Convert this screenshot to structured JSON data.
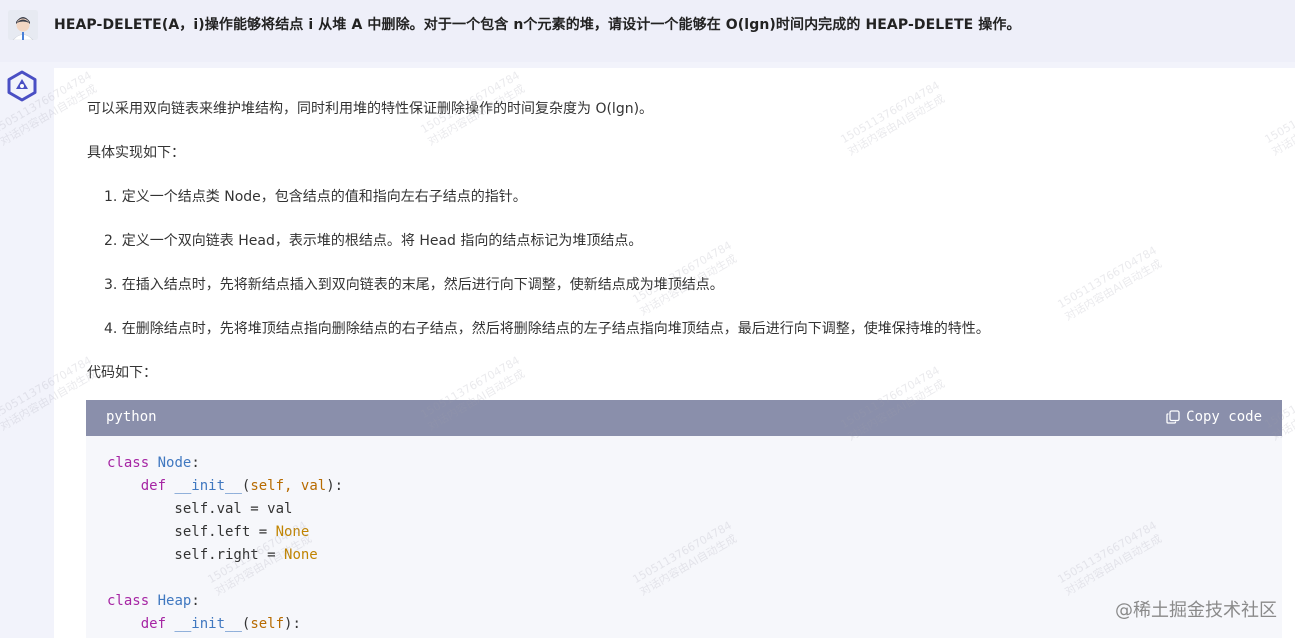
{
  "question": {
    "text": "HEAP-DELETE(A，i)操作能够将结点 i 从堆 A 中删除。对于一个包含 n个元素的堆，请设计一个能够在 O(lgn)时间内完成的 HEAP-DELETE 操作。"
  },
  "answer": {
    "intro": "可以采用双向链表来维护堆结构，同时利用堆的特性保证删除操作的时间复杂度为 O(lgn)。",
    "steps_heading": "具体实现如下：",
    "steps": [
      "1. 定义一个结点类 Node，包含结点的值和指向左右子结点的指针。",
      "2. 定义一个双向链表 Head，表示堆的根结点。将 Head 指向的结点标记为堆顶结点。",
      "3. 在插入结点时，先将新结点插入到双向链表的末尾，然后进行向下调整，使新结点成为堆顶结点。",
      "4. 在删除结点时，先将堆顶结点指向删除结点的右子结点，然后将删除结点的左子结点指向堆顶结点，最后进行向下调整，使堆保持堆的特性。"
    ],
    "code_heading": "代码如下："
  },
  "code_block": {
    "language": "python",
    "copy_label": "Copy code",
    "lines": [
      [
        {
          "t": "class",
          "c": "kw"
        },
        {
          "t": " "
        },
        {
          "t": "Node",
          "c": "cls"
        },
        {
          "t": ":"
        }
      ],
      [
        {
          "t": "    "
        },
        {
          "t": "def",
          "c": "kw"
        },
        {
          "t": " "
        },
        {
          "t": "__init__",
          "c": "fn"
        },
        {
          "t": "("
        },
        {
          "t": "self, val",
          "c": "param"
        },
        {
          "t": "):"
        }
      ],
      [
        {
          "t": "        self.val = val"
        }
      ],
      [
        {
          "t": "        self.left = "
        },
        {
          "t": "None",
          "c": "const"
        }
      ],
      [
        {
          "t": "        self.right = "
        },
        {
          "t": "None",
          "c": "const"
        }
      ],
      [
        {
          "t": ""
        }
      ],
      [
        {
          "t": "class",
          "c": "kw"
        },
        {
          "t": " "
        },
        {
          "t": "Heap",
          "c": "cls"
        },
        {
          "t": ":"
        }
      ],
      [
        {
          "t": "    "
        },
        {
          "t": "def",
          "c": "kw"
        },
        {
          "t": " "
        },
        {
          "t": "__init__",
          "c": "fn"
        },
        {
          "t": "("
        },
        {
          "t": "self",
          "c": "param"
        },
        {
          "t": "):"
        }
      ]
    ]
  },
  "watermark": {
    "line1": "15051137667​04784",
    "line2": "对话内容由AI自动生成"
  },
  "site_mark": "@稀土掘金技术社区",
  "colors": {
    "code_header_bg": "#8a8fab",
    "keyword": "#a626a4",
    "class_name": "#4078c0",
    "constant": "#c18401"
  },
  "icons": [
    "user-avatar-icon",
    "ai-logo-icon",
    "copy-icon"
  ]
}
